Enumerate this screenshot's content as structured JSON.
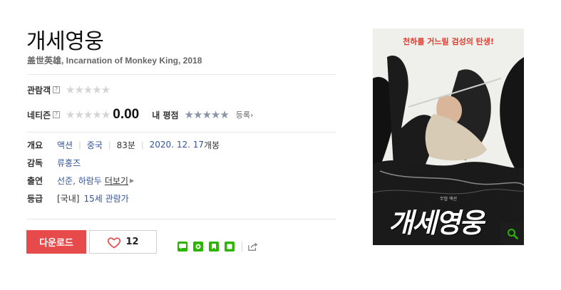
{
  "movie": {
    "title": "개세영웅",
    "subtitle": "盖世英雄, Incarnation of Monkey King, 2018"
  },
  "ratings": {
    "audience_label": "관람객",
    "netizen_label": "네티즌",
    "help_mark": "?",
    "stars": "★★★★★",
    "netizen_score": "0.00",
    "my_rating_label": "내 평점",
    "register_label": "등록›"
  },
  "info": {
    "overview_label": "개요",
    "genre": "액션",
    "country": "중국",
    "runtime": "83분",
    "release": "2020. 12. 17",
    "release_suffix": "개봉",
    "director_label": "감독",
    "director": "류홍즈",
    "cast_label": "출연",
    "cast": "선준, 하람두",
    "more_label": "더보기",
    "grade_label": "등급",
    "grade_region": "[국내]",
    "grade": "15세 관람가"
  },
  "actions": {
    "download_label": "다운로드",
    "like_count": "12"
  },
  "poster": {
    "tagline": "천하를 거느릴 검성의 탄생!",
    "genre_tag": "무협 액션",
    "title_art": "개세영웅"
  },
  "colors": {
    "download": "#e64a4a",
    "link": "#335599",
    "heart": "#e64a4a",
    "share_green": "#2db400"
  }
}
